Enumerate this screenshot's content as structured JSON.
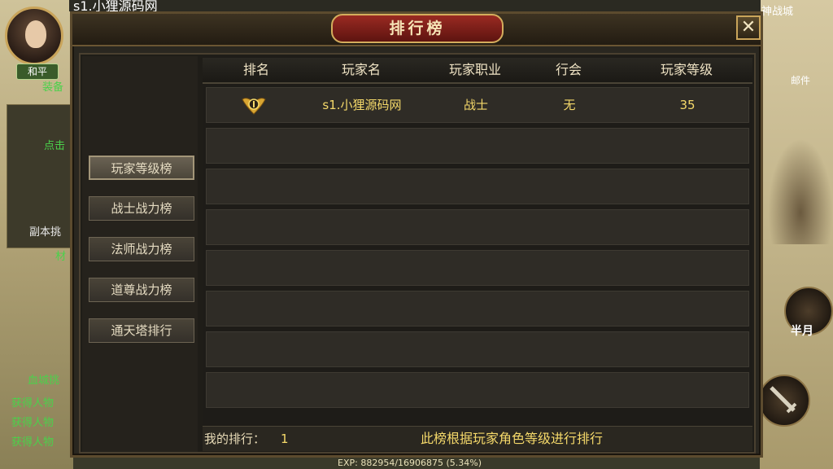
{
  "hud": {
    "server_name": "s1.小狸源码网",
    "mode_label": "和平",
    "map_label": "神战城",
    "mail_label": "邮件",
    "skill_label": "半月",
    "exp_text": "EXP: 882954/16906875 (5.34%)",
    "left_texts": [
      "装备",
      "点击",
      "副本挑",
      "材",
      "血城挑",
      "获得人物",
      "获得人物",
      "获得人物"
    ]
  },
  "dialog": {
    "title": "排行榜",
    "close_symbol": "✕",
    "tabs": [
      "玩家等级榜",
      "战士战力榜",
      "法师战力榜",
      "道尊战力榜",
      "通天塔排行"
    ],
    "active_tab": 0,
    "columns": [
      "排名",
      "玩家名",
      "玩家职业",
      "行会",
      "玩家等级"
    ],
    "rows": [
      {
        "player": "s1.小狸源码网",
        "class": "战士",
        "guild": "无",
        "level": "35"
      }
    ],
    "empty_rows": 7,
    "footer": {
      "my_rank_label": "我的排行：",
      "my_rank_value": "1",
      "note": "此榜根据玩家角色等级进行排行"
    }
  },
  "colors": {
    "accent_gold": "#f5d96a",
    "title_red": "#9a2a22",
    "frame_gold": "#c9a45a"
  }
}
